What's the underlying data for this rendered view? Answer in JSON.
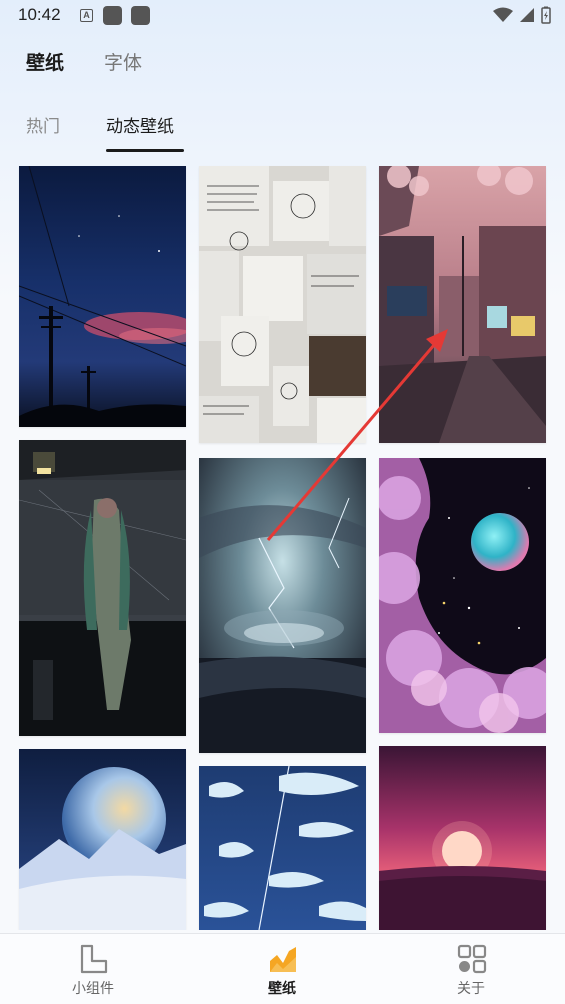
{
  "status_bar": {
    "time": "10:42",
    "notification_icons": [
      "a-icon",
      "square-icon",
      "square-icon"
    ],
    "right_icons": [
      "wifi-icon",
      "signal-icon",
      "battery-icon"
    ]
  },
  "main_tabs": [
    {
      "label": "壁纸",
      "active": true
    },
    {
      "label": "字体",
      "active": false
    }
  ],
  "sub_tabs": [
    {
      "label": "热门",
      "active": false
    },
    {
      "label": "动态壁纸",
      "active": true
    }
  ],
  "wallpapers": [
    {
      "name": "night-power-lines",
      "column": 0
    },
    {
      "name": "anime-girl-window",
      "column": 0
    },
    {
      "name": "snowy-planet",
      "column": 0
    },
    {
      "name": "sketch-collage",
      "column": 1
    },
    {
      "name": "storm-sea-vortex",
      "column": 1
    },
    {
      "name": "sky-fish",
      "column": 1
    },
    {
      "name": "pink-city-street",
      "column": 2
    },
    {
      "name": "galaxy-nebula-planet",
      "column": 2
    },
    {
      "name": "pink-sunset-sea",
      "column": 2
    }
  ],
  "bottom_nav": [
    {
      "label": "小组件",
      "icon": "widget-icon",
      "active": false
    },
    {
      "label": "壁纸",
      "icon": "wallpaper-icon",
      "active": true
    },
    {
      "label": "关于",
      "icon": "grid-icon",
      "active": false
    }
  ],
  "colors": {
    "accent_orange": "#f5a623",
    "annotation_arrow": "#e53935",
    "text_active": "#1b1b1b",
    "text_inactive": "#8a8a8a"
  }
}
